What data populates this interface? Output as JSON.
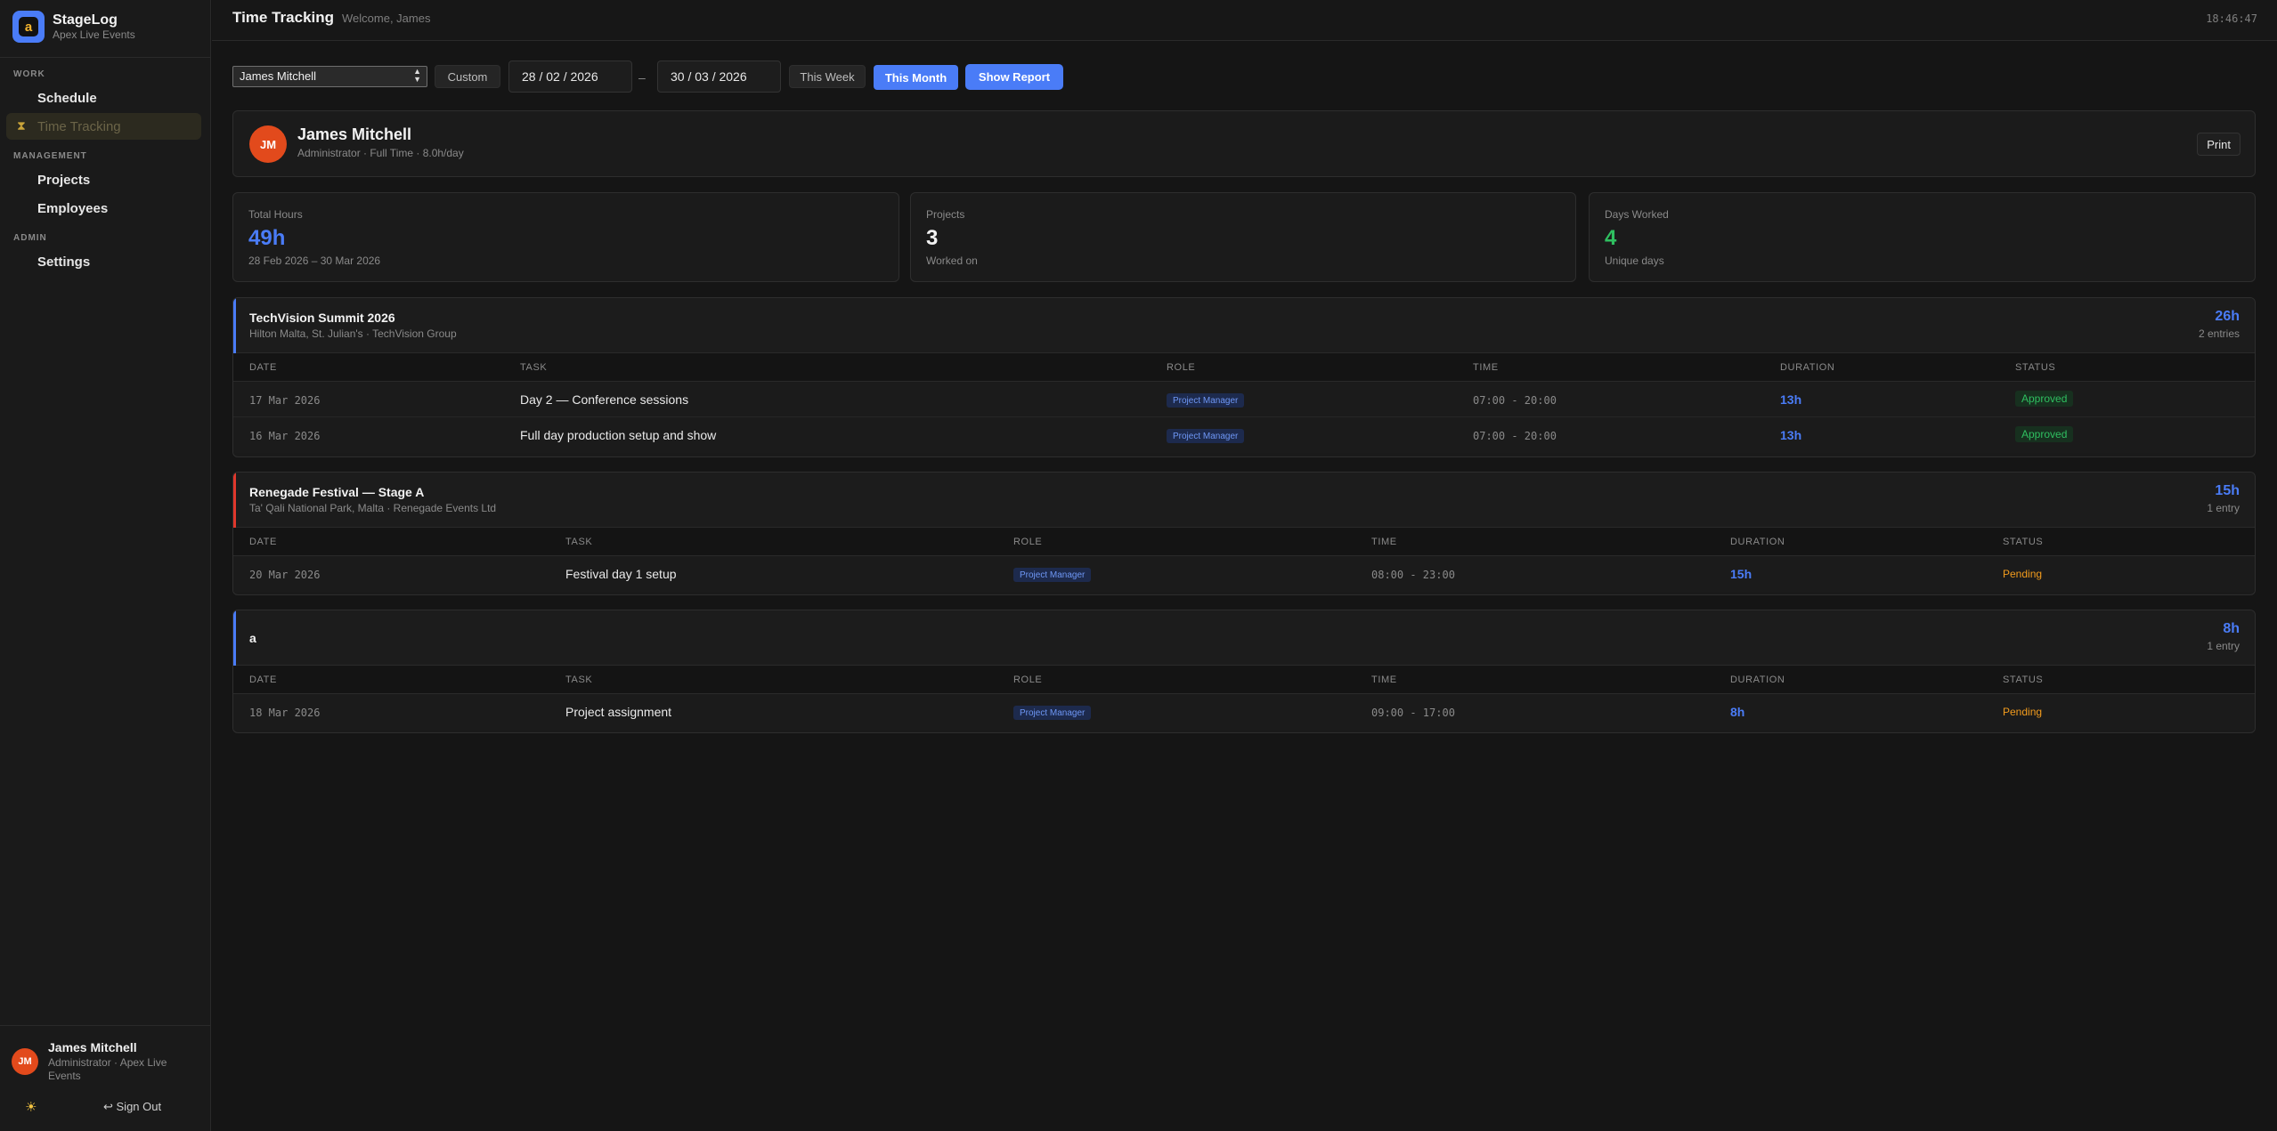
{
  "app": {
    "name": "StageLog",
    "org": "Apex Live Events",
    "logo_glyph": "a"
  },
  "nav": {
    "sections": [
      {
        "label": "WORK",
        "items": [
          {
            "label": "Schedule"
          },
          {
            "label": "Time Tracking",
            "active": true
          }
        ]
      },
      {
        "label": "MANAGEMENT",
        "items": [
          {
            "label": "Projects"
          },
          {
            "label": "Employees"
          }
        ]
      },
      {
        "label": "ADMIN",
        "items": [
          {
            "label": "Settings"
          }
        ]
      }
    ]
  },
  "user": {
    "initials": "JM",
    "name": "James Mitchell",
    "role": "Administrator · Apex Live Events",
    "signout": "↩ Sign Out",
    "theme_icon": "☀"
  },
  "header": {
    "title": "Time Tracking",
    "welcome": "Welcome, James",
    "clock": "18:46:47"
  },
  "filters": {
    "employee": "James Mitchell",
    "custom": "Custom",
    "from": "28 / 02 / 2026",
    "to": "30 / 03 / 2026",
    "dash": "–",
    "this_week": "This Week",
    "this_month": "This Month",
    "show_report": "Show Report"
  },
  "employee": {
    "initials": "JM",
    "name": "James Mitchell",
    "meta": "Administrator · Full Time · 8.0h/day",
    "print": "Print"
  },
  "stats": {
    "total_hours": {
      "label": "Total Hours",
      "value": "49h",
      "sub": "28 Feb 2026 – 30 Mar 2026",
      "color": "#4a7cf7"
    },
    "projects": {
      "label": "Projects",
      "value": "3",
      "sub": "Worked on",
      "color": "#f2f2f2"
    },
    "days": {
      "label": "Days Worked",
      "value": "4",
      "sub": "Unique days",
      "color": "#2fbf60"
    }
  },
  "columns": {
    "date": "DATE",
    "task": "TASK",
    "role": "ROLE",
    "time": "TIME",
    "duration": "DURATION",
    "status": "STATUS"
  },
  "projects": [
    {
      "title": "TechVision Summit 2026",
      "sub": "Hilton Malta, St. Julian's · TechVision Group",
      "total": "26h",
      "count": "2 entries",
      "color": "#4a7cf7",
      "rows": [
        {
          "date": "17 Mar 2026",
          "task": "Day 2 — Conference sessions",
          "role": "Project Manager",
          "time": "07:00 - 20:00",
          "duration": "13h",
          "status": "Approved"
        },
        {
          "date": "16 Mar 2026",
          "task": "Full day production setup and show",
          "role": "Project Manager",
          "time": "07:00 - 20:00",
          "duration": "13h",
          "status": "Approved"
        }
      ]
    },
    {
      "title": "Renegade Festival — Stage A",
      "sub": "Ta' Qali National Park, Malta · Renegade Events Ltd",
      "total": "15h",
      "count": "1 entry",
      "color": "#e0382c",
      "rows": [
        {
          "date": "20 Mar 2026",
          "task": "Festival day 1 setup",
          "role": "Project Manager",
          "time": "08:00 - 23:00",
          "duration": "15h",
          "status": "Pending"
        }
      ]
    },
    {
      "title": "a",
      "sub": "",
      "total": "8h",
      "count": "1 entry",
      "color": "#4a7cf7",
      "rows": [
        {
          "date": "18 Mar 2026",
          "task": "Project assignment",
          "role": "Project Manager",
          "time": "09:00 - 17:00",
          "duration": "8h",
          "status": "Pending"
        }
      ]
    }
  ]
}
